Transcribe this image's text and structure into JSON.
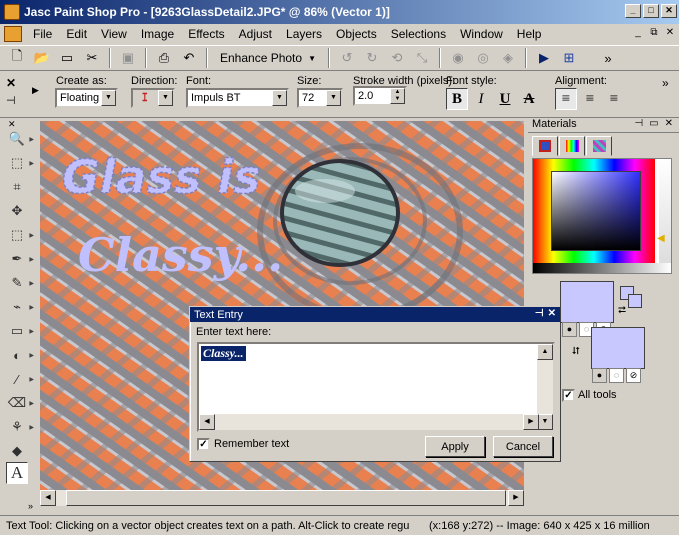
{
  "window": {
    "title": "Jasc Paint Shop Pro - [9263GlassDetail2.JPG* @ 86% (Vector 1)]",
    "minimize": "_",
    "maximize": "□",
    "close": "✕"
  },
  "menu": {
    "items": [
      {
        "label": "File"
      },
      {
        "label": "Edit"
      },
      {
        "label": "View"
      },
      {
        "label": "Image"
      },
      {
        "label": "Effects"
      },
      {
        "label": "Adjust"
      },
      {
        "label": "Layers"
      },
      {
        "label": "Objects"
      },
      {
        "label": "Selections"
      },
      {
        "label": "Window"
      },
      {
        "label": "Help"
      }
    ],
    "mdi_minimize": "_",
    "mdi_restore": "⧉",
    "mdi_close": "✕"
  },
  "toolbar": {
    "enhance_label": "Enhance Photo",
    "more": "»"
  },
  "tool_options": {
    "create_as_label": "Create as:",
    "create_as_value": "Floating",
    "direction_label": "Direction:",
    "font_label": "Font:",
    "font_value": "Impuls BT",
    "size_label": "Size:",
    "size_value": "72",
    "stroke_label": "Stroke width (pixels):",
    "stroke_value": "2.0",
    "font_style_label": "Font style:",
    "alignment_label": "Alignment:",
    "bold": "B",
    "italic": "I",
    "underline": "U",
    "strike": "A",
    "more": "»"
  },
  "canvas": {
    "text_line1": "Glass is",
    "text_line2": "Classy..."
  },
  "text_entry": {
    "title": "Text Entry",
    "pin": "⊣",
    "close": "✕",
    "prompt": "Enter text here:",
    "text": "Classy...",
    "remember_label": "Remember text",
    "remember_checked": true,
    "apply": "Apply",
    "cancel": "Cancel"
  },
  "materials": {
    "title": "Materials",
    "all_tools_label": "All tools",
    "all_tools_checked": true,
    "foreground_color": "#c8c8ff",
    "background_color": "#c8c8ff"
  },
  "status": {
    "left": "Text Tool: Clicking on a vector object creates text on a path. Alt-Click to create regu",
    "right": "(x:168 y:272) -- Image:  640 x 425 x 16 million"
  }
}
